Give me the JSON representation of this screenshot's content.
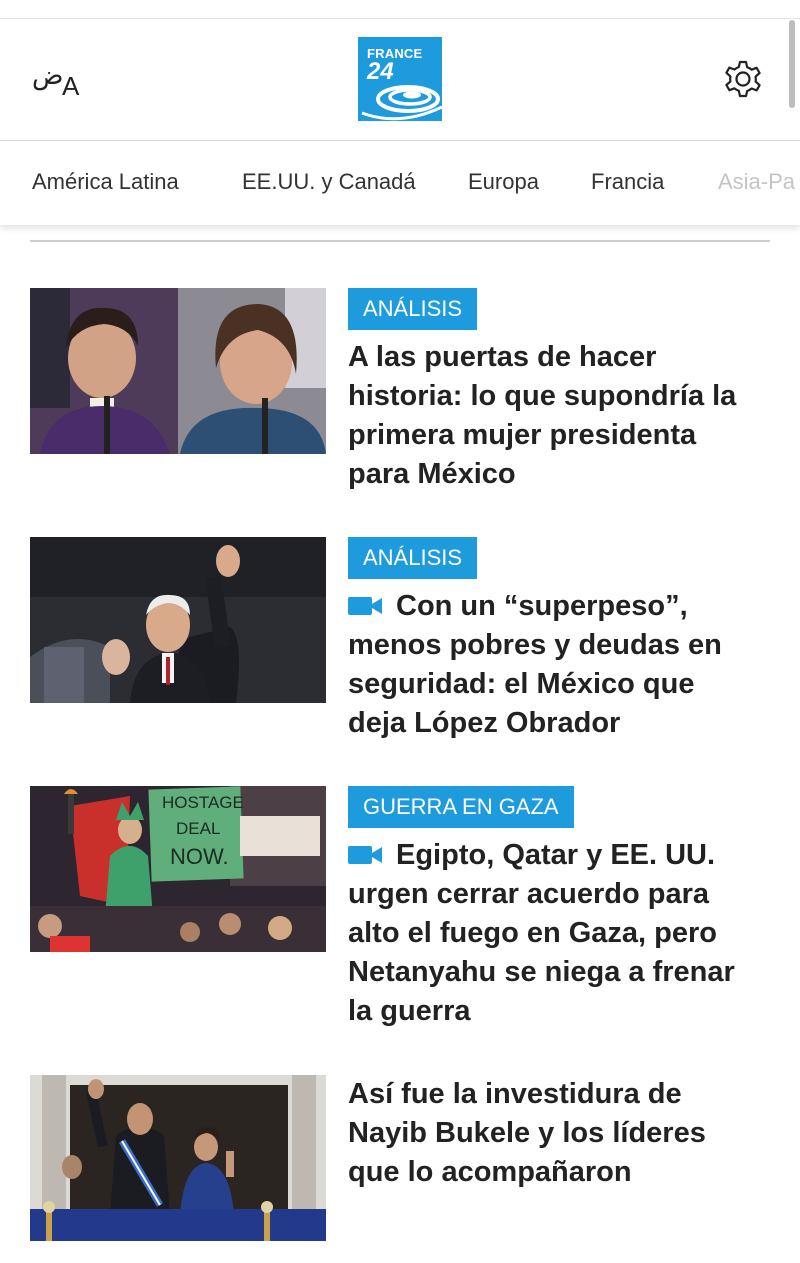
{
  "header": {
    "lang_arabic": "ض",
    "lang_latin": "A",
    "logo_line1": "FRANCE",
    "logo_line2": "24"
  },
  "tabs": [
    "América Latina",
    "EE.UU. y Canadá",
    "Europa",
    "Francia",
    "Asia-Pa"
  ],
  "articles": [
    {
      "tag": "ANÁLISIS",
      "has_video": false,
      "title": "A las puertas de hacer historia: lo que supondría la primera mujer presidenta para México"
    },
    {
      "tag": "ANÁLISIS",
      "has_video": true,
      "title": "Con un “superpeso”, menos pobres y deudas en seguridad: el México que deja López Obrador"
    },
    {
      "tag": "GUERRA EN GAZA",
      "has_video": true,
      "title": "Egipto, Qatar y EE. UU. urgen cerrar acuerdo para alto el fuego en Gaza, pero Netanyahu se niega a frenar la guerra"
    },
    {
      "tag": "",
      "has_video": false,
      "title": "Así fue la investidura de Nayib Bukele y los líderes que lo acompañaron"
    }
  ],
  "photo_sign_text": [
    "HOSTAGE",
    "DEAL",
    "NOW."
  ],
  "colors": {
    "accent": "#1e9bdc",
    "text": "#222222"
  },
  "icons": [
    "language-toggle-icon",
    "settings-gear-icon",
    "video-camera-icon"
  ]
}
